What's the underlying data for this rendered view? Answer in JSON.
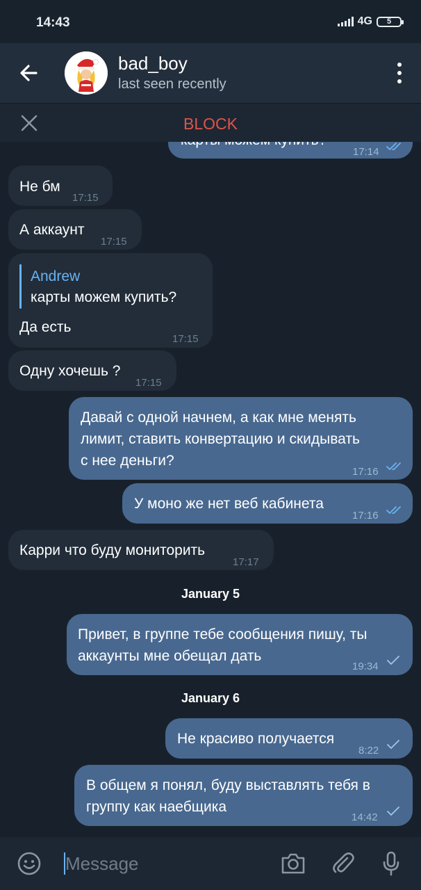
{
  "status_bar": {
    "time": "14:43",
    "network": "4G",
    "battery": "5"
  },
  "header": {
    "name": "bad_boy",
    "status": "last seen recently"
  },
  "block_bar": {
    "label": "BLOCK"
  },
  "messages": [
    {
      "dir": "out",
      "text": "карты можем купить?",
      "time": "17:14",
      "read": true
    },
    {
      "dir": "in",
      "text": "Не бм",
      "time": "17:15"
    },
    {
      "dir": "in",
      "text": "А аккаунт",
      "time": "17:15"
    },
    {
      "dir": "in",
      "reply_to": "Andrew",
      "reply_text": "карты можем купить?",
      "text": "Да есть",
      "time": "17:15"
    },
    {
      "dir": "in",
      "text": "Одну хочешь ?",
      "time": "17:15"
    },
    {
      "dir": "out",
      "text": "Давай с одной начнем, а как мне менять\nлимит, ставить конвертацию и скидывать\nс нее деньги?",
      "time": "17:16",
      "read": true
    },
    {
      "dir": "out",
      "text": "У моно же нет веб кабинета",
      "time": "17:16",
      "read": true
    },
    {
      "dir": "in",
      "text": "Карри что буду мониторить",
      "time": "17:17"
    },
    {
      "dir": "out",
      "text": "Привет, в группе тебе сообщения пишу, ты\nаккаунты мне обещал дать",
      "time": "19:34",
      "read": false
    },
    {
      "dir": "out",
      "text": "Не красиво получается",
      "time": "8:22",
      "read": false
    },
    {
      "dir": "out",
      "text": "В общем я понял, буду выставлять тебя в\nгруппу как наебщика",
      "time": "14:42",
      "read": false
    }
  ],
  "date_separators": [
    "January 5",
    "January 6"
  ],
  "input": {
    "placeholder": "Message"
  },
  "icons": {
    "back": "arrow-left-icon",
    "menu": "more-vertical-icon",
    "close": "close-icon",
    "emoji": "emoji-icon",
    "camera": "camera-icon",
    "attach": "paperclip-icon",
    "mic": "microphone-icon",
    "ticks": "double-check-icon"
  },
  "colors": {
    "accent": "#6ab2f2",
    "block": "#e0534a",
    "bubble_out": "#48688f",
    "bubble_in": "#222d39",
    "background": "#18212b"
  }
}
